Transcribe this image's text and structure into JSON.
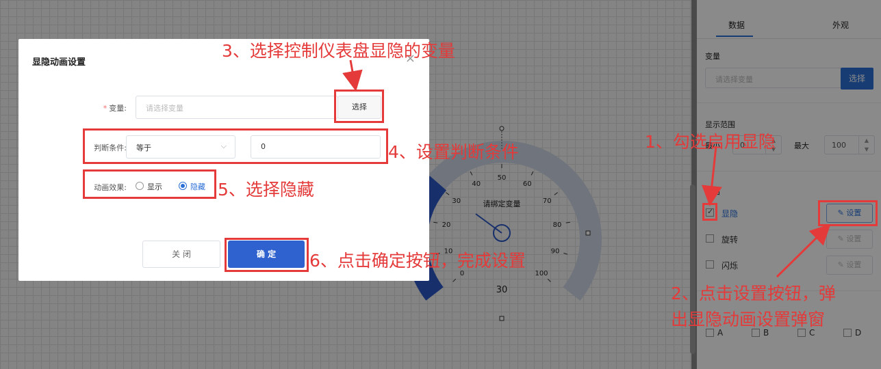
{
  "panel": {
    "tabs": [
      "数据",
      "外观"
    ],
    "variable_label": "变量",
    "variable_placeholder": "请选择变量",
    "select_button": "选择",
    "range_label": "显示范围",
    "min_label": "最小",
    "min_value": "0",
    "max_label": "最大",
    "max_value": "100",
    "anim_label": "动画",
    "anim_items": [
      {
        "label": "显隐",
        "checked": true,
        "button": "设置"
      },
      {
        "label": "旋转",
        "checked": false,
        "button": "设置"
      },
      {
        "label": "闪烁",
        "checked": false,
        "button": "设置"
      }
    ],
    "abcd": [
      "A",
      "B",
      "C",
      "D"
    ]
  },
  "dialog": {
    "title": "显隐动画设置",
    "close_icon": "×",
    "variable_label": "变量:",
    "variable_placeholder": "请选择变量",
    "select_button": "选择",
    "condition_label": "判断条件:",
    "condition_value": "等于",
    "condition_input": "0",
    "effect_label": "动画效果:",
    "effect_options": [
      "显示",
      "隐藏"
    ],
    "effect_selected": "隐藏",
    "close_button": "关 闭",
    "ok_button": "确 定"
  },
  "gauge": {
    "caption": "请绑定变量",
    "ticks": [
      "0",
      "10",
      "20",
      "30",
      "40",
      "50",
      "60",
      "70",
      "80",
      "90",
      "100"
    ],
    "value": "30"
  },
  "annotations": {
    "step1": "1、勾选启用显隐",
    "step2_line1": "2、点击设置按钮，弹",
    "step2_line2": "出显隐动画设置弹窗",
    "step3": "3、选择控制仪表盘显隐的变量",
    "step4": "4、设置判断条件",
    "step5": "5、选择隐藏",
    "step6": "6、点击确定按钮，完成设置"
  },
  "colors": {
    "accent": "#2b6fd6",
    "annotation": "#e43a3a"
  }
}
